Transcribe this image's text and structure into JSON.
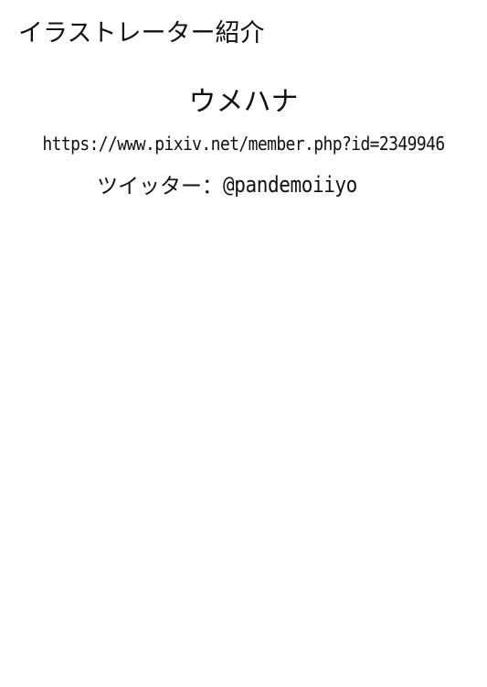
{
  "heading": "イラストレーター紹介",
  "artist": {
    "name": "ウメハナ",
    "pixiv_url": "https://www.pixiv.net/member.php?id=2349946",
    "twitter_label": "ツイッター：",
    "twitter_handle": "@pandemoiiyo"
  }
}
